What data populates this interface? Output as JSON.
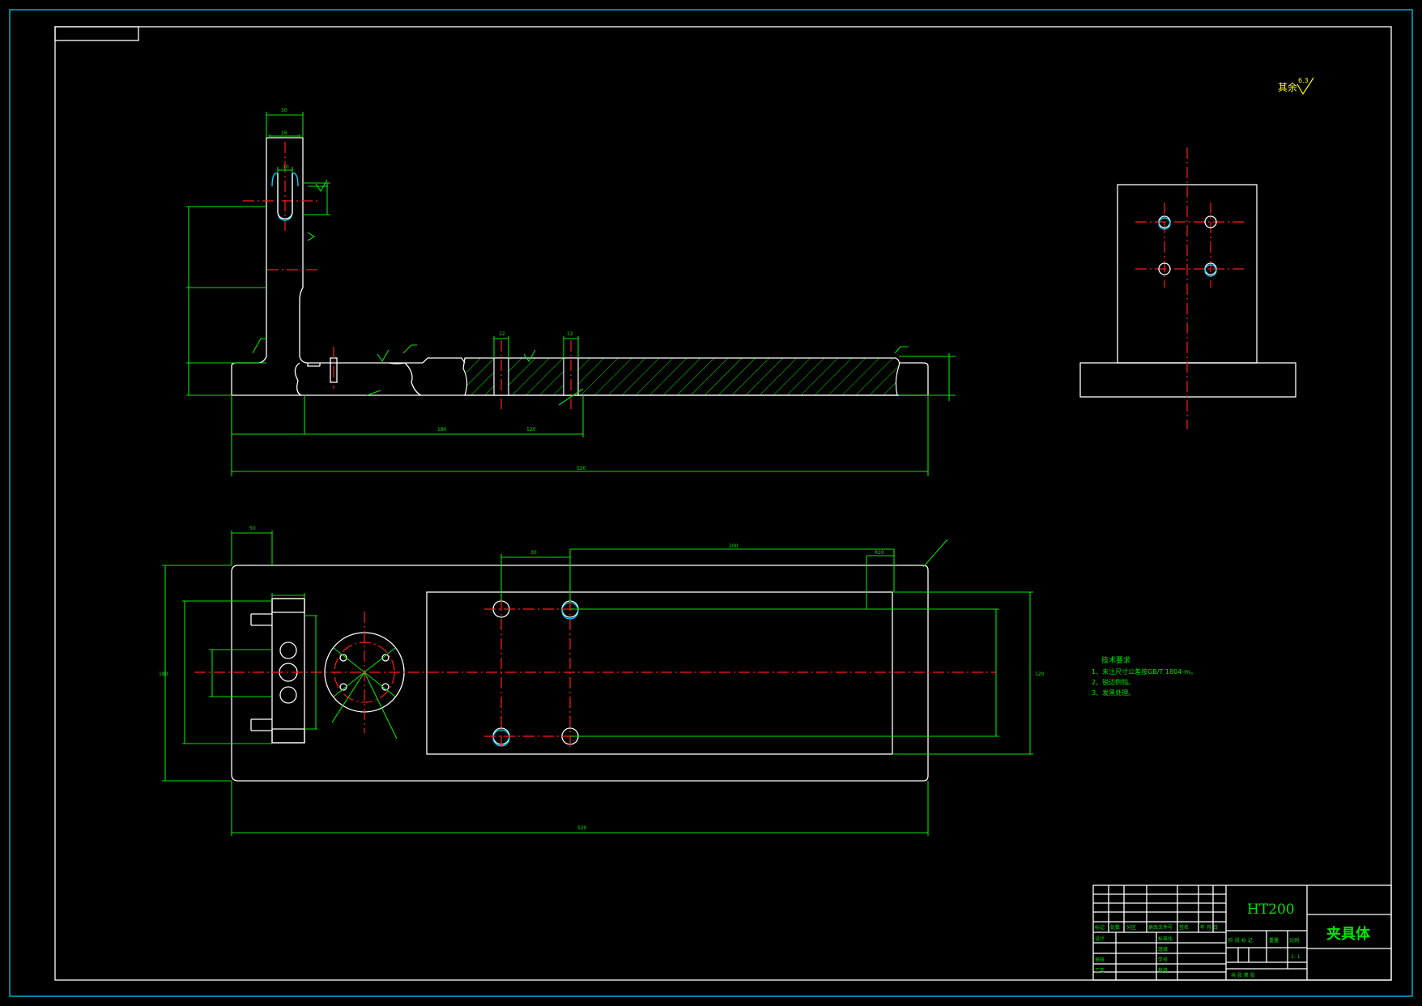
{
  "title_block": {
    "material": "HT200",
    "part_name": "夹具体",
    "scale": "1: 1",
    "header_labels": [
      "标记",
      "处数",
      "分区",
      "更改文件号",
      "签名",
      "年 月 日"
    ],
    "role_labels": [
      "设计",
      "标准化",
      "审核",
      "工艺",
      "批准"
    ],
    "mid_labels": [
      "班级",
      "学号"
    ],
    "stage_labels": "阶 段 标 记",
    "weight_label": "重量",
    "scale_label": "比例",
    "sheet_labels": "共 张 第 张"
  },
  "technical_requirements": {
    "heading": "技术要求",
    "items": [
      "1、未注尺寸公差按GB/T 1804-m。",
      "2、锐边倒钝。",
      "3、发黑处理。"
    ]
  },
  "surface_finish_note": {
    "label": "其余",
    "value": "6.3"
  },
  "colors": {
    "outline": "#ffffff",
    "dimension": "#00e400",
    "centerline": "#ff1a1a",
    "frame": "#00d8ff",
    "note": "#ffff00"
  }
}
